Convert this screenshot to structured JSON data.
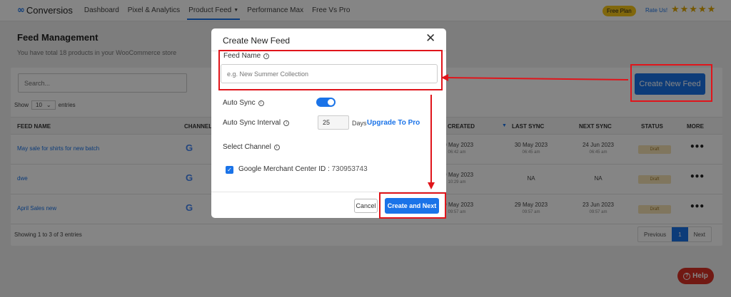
{
  "nav": {
    "logo": "Conversios",
    "items": [
      "Dashboard",
      "Pixel & Analytics",
      "Product Feed",
      "Performance Max",
      "Free Vs Pro"
    ],
    "plan_badge": "Free Plan",
    "rate_label": "Rate Us!",
    "stars": "★★★★★"
  },
  "page": {
    "title": "Feed Management",
    "subtitle": "You have total 18 products in your WooCommerce store",
    "search_placeholder": "Search...",
    "show_label": "Show",
    "entries_value": "10",
    "entries_label": "entries",
    "create_feed_button": "Create New Feed",
    "showing_text": "Showing 1 to 3 of 3 entries",
    "pager": {
      "previous": "Previous",
      "current": "1",
      "next": "Next"
    },
    "help_label": "Help"
  },
  "table": {
    "headers": {
      "feed_name": "FEED NAME",
      "channels": "CHANNELS",
      "created": "CREATED",
      "last_sync": "LAST SYNC",
      "next_sync": "NEXT SYNC",
      "status": "STATUS",
      "more": "MORE"
    },
    "rows": [
      {
        "name": "May sale for shirts for new batch",
        "created_date": "30 May 2023",
        "created_time": "06:42 am",
        "last_date": "30 May 2023",
        "last_time": "06:45 am",
        "next_date": "24 Jun 2023",
        "next_time": "06:45 am",
        "status": "Draft"
      },
      {
        "name": "dwe",
        "created_date": "29 May 2023",
        "created_time": "10:29 am",
        "last_date": "NA",
        "last_time": "",
        "next_date": "NA",
        "next_time": "",
        "status": "Draft"
      },
      {
        "name": "April Sales new",
        "created_date": "29 May 2023",
        "created_time": "09:57 am",
        "last_date": "29 May 2023",
        "last_time": "09:57 am",
        "next_date": "23 Jun 2023",
        "next_time": "09:57 am",
        "status": "Draft"
      }
    ]
  },
  "modal": {
    "title": "Create New Feed",
    "feed_name_label": "Feed Name",
    "feed_name_placeholder": "e.g. New Summer Collection",
    "auto_sync_label": "Auto Sync",
    "auto_sync_interval_label": "Auto Sync Interval",
    "interval_value": "25",
    "days_label": "Days",
    "upgrade_label": "Upgrade To Pro",
    "select_channel_label": "Select Channel",
    "channel_label": "Google Merchant Center ID :",
    "channel_id": "730953743",
    "cancel_label": "Cancel",
    "next_label": "Create and Next"
  },
  "icons": [
    "conversios-logo-icon",
    "caret-down-icon",
    "star-icon",
    "google-icon",
    "more-dots-icon",
    "sort-icon",
    "close-icon",
    "info-icon",
    "check-icon",
    "help-icon"
  ],
  "colors": {
    "accent": "#1a73e8",
    "annotation": "#e0151b",
    "plan_badge": "#f5c518",
    "help": "#d93025",
    "draft_badge": "#f6e3b4"
  }
}
